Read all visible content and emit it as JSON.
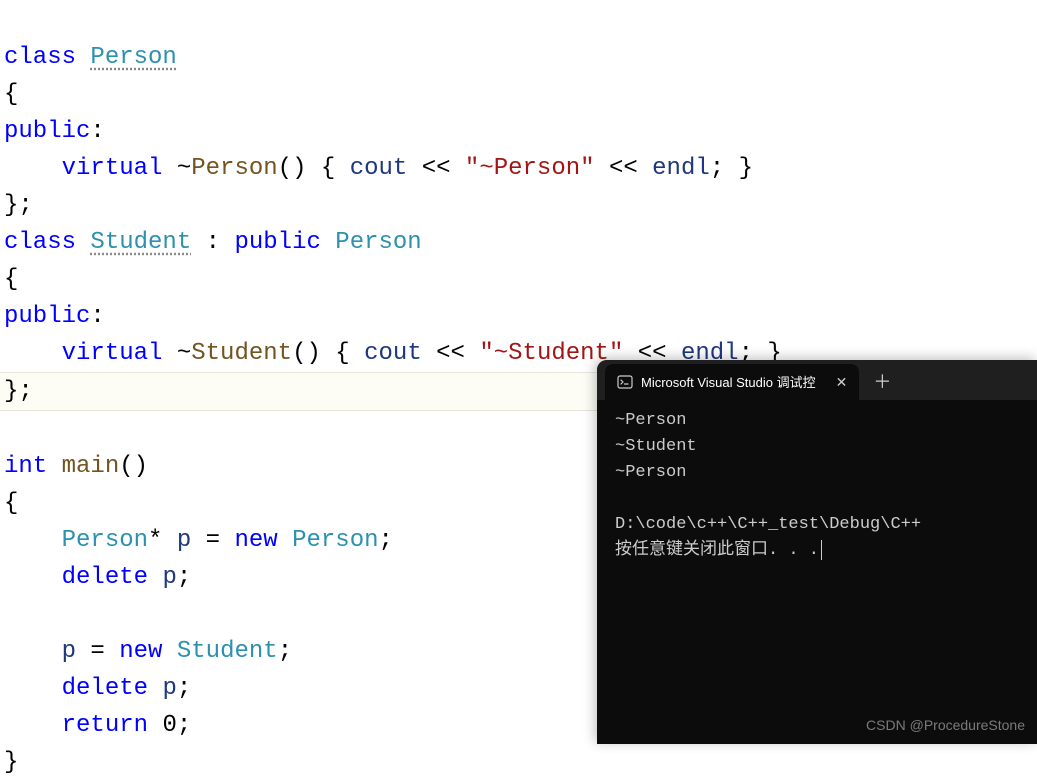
{
  "code": {
    "line1": {
      "kw_class": "class",
      "type": "Person"
    },
    "line2": "{",
    "line3": {
      "kw_public": "public",
      "colon": ":"
    },
    "line4": {
      "indent": "    ",
      "kw_virtual": "virtual",
      "tilde": "~",
      "dtor": "Person",
      "parens": "()",
      "lbrace": " { ",
      "cout": "cout",
      "op1": " << ",
      "str": "\"~Person\"",
      "op2": " << ",
      "endl": "endl",
      "semi": "; ",
      "rbrace": "}"
    },
    "line5": "};",
    "line6": {
      "kw_class": "class",
      "type": "Student",
      "sep": " : ",
      "kw_public": "public",
      "base": "Person"
    },
    "line7": "{",
    "line8": {
      "kw_public": "public",
      "colon": ":"
    },
    "line9": {
      "indent": "    ",
      "kw_virtual": "virtual",
      "tilde": "~",
      "dtor": "Student",
      "parens": "()",
      "lbrace": " { ",
      "cout": "cout",
      "op1": " << ",
      "str": "\"~Student\"",
      "op2": " << ",
      "endl": "endl",
      "semi": "; ",
      "rbrace": "}"
    },
    "line10": "};",
    "line11": {
      "kw_int": "int",
      "main": "main",
      "parens": "()"
    },
    "line12": "{",
    "line13": {
      "indent": "    ",
      "type": "Person",
      "star": "* ",
      "var": "p",
      "eq": " = ",
      "kw_new": "new",
      "sp": " ",
      "ctor": "Person",
      "semi": ";"
    },
    "line14": {
      "indent": "    ",
      "kw_delete": "delete",
      "sp": " ",
      "var": "p",
      "semi": ";"
    },
    "line15": "",
    "line16": {
      "indent": "    ",
      "var": "p",
      "eq": " = ",
      "kw_new": "new",
      "sp": " ",
      "ctor": "Student",
      "semi": ";"
    },
    "line17": {
      "indent": "    ",
      "kw_delete": "delete",
      "sp": " ",
      "var": "p",
      "semi": ";"
    },
    "line18": {
      "indent": "    ",
      "kw_return": "return",
      "sp": " ",
      "num": "0",
      "semi": ";"
    },
    "line19": "}"
  },
  "terminal": {
    "tab_title": "Microsoft Visual Studio 调试控",
    "output_lines": [
      "~Person",
      "~Student",
      "~Person",
      "",
      "D:\\code\\c++\\C++_test\\Debug\\C++",
      "按任意键关闭此窗口. . ."
    ],
    "watermark": "CSDN @ProcedureStone"
  }
}
